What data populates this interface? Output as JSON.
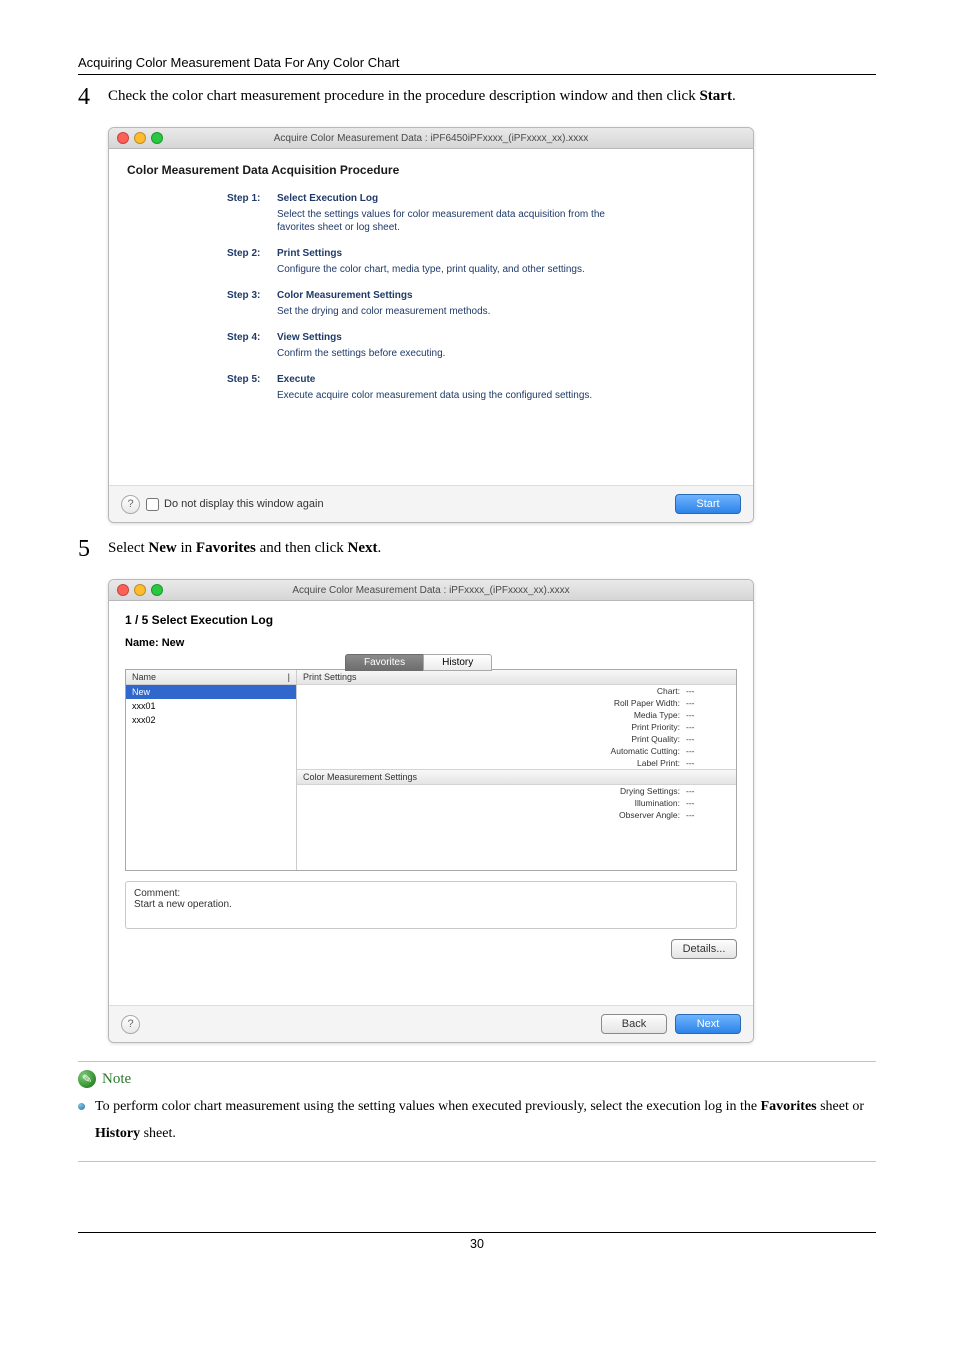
{
  "doc": {
    "section_title": "Acquiring Color Measurement Data For Any Color Chart",
    "page_number": "30"
  },
  "step4": {
    "num": "4",
    "text_a": "Check the color chart measurement procedure in the procedure description window and then click ",
    "text_b": "Start",
    "text_c": "."
  },
  "step5": {
    "num": "5",
    "text_a": "Select ",
    "text_b": "New",
    "text_c": " in ",
    "text_d": "Favorites",
    "text_e": " and then click ",
    "text_f": "Next",
    "text_g": "."
  },
  "win1": {
    "title": "Acquire Color Measurement Data : iPF6450iPFxxxx_(iPFxxxx_xx).xxxx",
    "heading": "Color Measurement Data Acquisition Procedure",
    "steps": [
      {
        "label": "Step 1:",
        "title": "Select Execution Log",
        "desc": "Select the settings values for color measurement data acquisition from the favorites sheet or log sheet."
      },
      {
        "label": "Step 2:",
        "title": "Print Settings",
        "desc": "Configure the color chart, media type, print quality, and other settings."
      },
      {
        "label": "Step 3:",
        "title": "Color Measurement Settings",
        "desc": "Set the drying and color measurement methods."
      },
      {
        "label": "Step 4:",
        "title": "View Settings",
        "desc": "Confirm the settings before executing."
      },
      {
        "label": "Step 5:",
        "title": "Execute",
        "desc": "Execute acquire color measurement data using the configured settings."
      }
    ],
    "checkbox_label": "Do not display this window again",
    "start_btn": "Start"
  },
  "win2": {
    "title": "Acquire Color Measurement Data : iPFxxxx_(iPFxxxx_xx).xxxx",
    "heading": "1 / 5 Select Execution Log",
    "name_label": "Name:",
    "name_value": "New",
    "tab_fav": "Favorites",
    "tab_hist": "History",
    "list_head_name": "Name",
    "list": [
      "New",
      "xxx01",
      "xxx02"
    ],
    "print_head": "Print Settings",
    "print_rows": [
      {
        "k": "Chart:",
        "v": "---"
      },
      {
        "k": "Roll Paper Width:",
        "v": "---"
      },
      {
        "k": "Media Type:",
        "v": "---"
      },
      {
        "k": "Print Priority:",
        "v": "---"
      },
      {
        "k": "Print Quality:",
        "v": "---"
      },
      {
        "k": "Automatic Cutting:",
        "v": "---"
      },
      {
        "k": "Label Print:",
        "v": "---"
      }
    ],
    "cms_head": "Color Measurement Settings",
    "cms_rows": [
      {
        "k": "Drying Settings:",
        "v": "---"
      },
      {
        "k": "Illumination:",
        "v": "---"
      },
      {
        "k": "Observer Angle:",
        "v": "---"
      }
    ],
    "comment_label": "Comment:",
    "comment_text": "Start a new operation.",
    "details_btn": "Details...",
    "back_btn": "Back",
    "next_btn": "Next"
  },
  "note": {
    "title": "Note",
    "item_a": "To perform color chart measurement using the setting values when executed previously, select the execution log in the ",
    "item_b": "Favorites",
    "item_c": " sheet or ",
    "item_d": "History",
    "item_e": " sheet."
  }
}
